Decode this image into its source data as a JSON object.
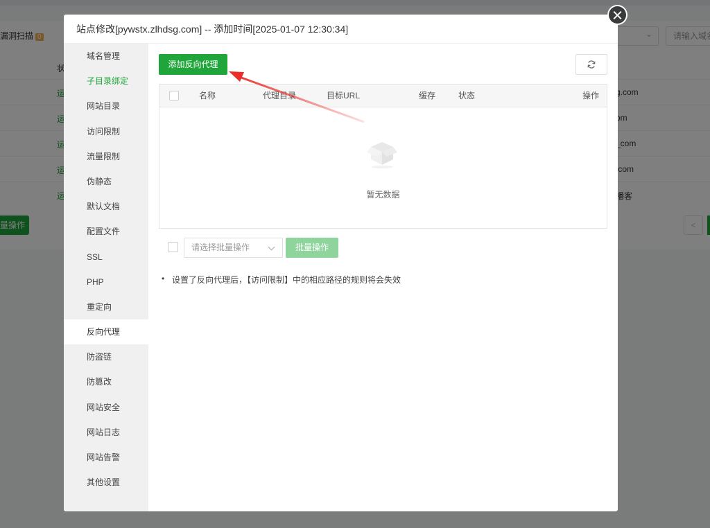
{
  "background": {
    "scan_label": "漏洞扫描",
    "scan_count": "0",
    "search_placeholder": "请输入域名",
    "header_k": "状",
    "run_char": "运",
    "rows": [
      {
        "domain": "g.com"
      },
      {
        "domain": "om"
      },
      {
        "domain": "_com"
      },
      {
        "domain": ".com"
      },
      {
        "domain": "播客"
      }
    ],
    "batch_label": "量操作",
    "prev_label": "<"
  },
  "modal": {
    "title": "站点修改[pywstx.zlhdsg.com] -- 添加时间[2025-01-07 12:30:34]"
  },
  "sidebar": {
    "items": [
      {
        "label": "域名管理"
      },
      {
        "label": "子目录绑定"
      },
      {
        "label": "网站目录"
      },
      {
        "label": "访问限制"
      },
      {
        "label": "流量限制"
      },
      {
        "label": "伪静态"
      },
      {
        "label": "默认文档"
      },
      {
        "label": "配置文件"
      },
      {
        "label": "SSL"
      },
      {
        "label": "PHP"
      },
      {
        "label": "重定向"
      },
      {
        "label": "反向代理"
      },
      {
        "label": "防盗链"
      },
      {
        "label": "防篡改"
      },
      {
        "label": "网站安全"
      },
      {
        "label": "网站日志"
      },
      {
        "label": "网站告警"
      },
      {
        "label": "其他设置"
      }
    ]
  },
  "toolbar": {
    "add_label": "添加反向代理"
  },
  "table": {
    "headers": {
      "name": "名称",
      "proxy_dir": "代理目录",
      "target_url": "目标URL",
      "cache": "缓存",
      "status": "状态",
      "actions": "操作"
    },
    "empty_text": "暂无数据"
  },
  "batch": {
    "placeholder": "请选择批量操作",
    "button": "批量操作"
  },
  "note": "设置了反向代理后，【访问限制】中的相应路径的规则将会失效",
  "colors": {
    "accent": "#20a53a",
    "arrow": "#e8302a"
  }
}
